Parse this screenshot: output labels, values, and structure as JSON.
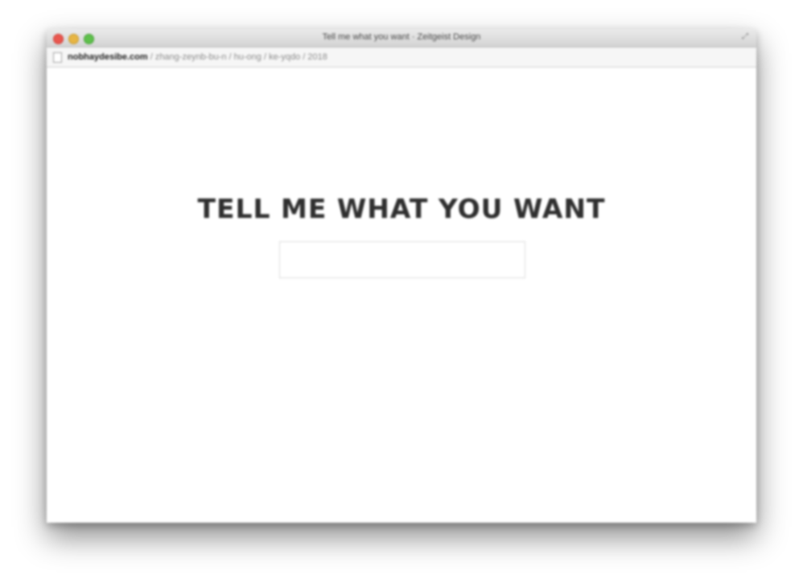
{
  "window": {
    "title": "Tell me what you want · Zeitgeist Design",
    "url_domain": "nobhaydesibe.com",
    "url_path": "/ zhang-zeynb-bu-n / hu-ong / ke-yqdo / 2018"
  },
  "page": {
    "headline": "TELL ME WHAT YOU WANT",
    "input_value": "",
    "input_placeholder": ""
  },
  "icons": {
    "close": "close-icon",
    "minimize": "minimize-icon",
    "maximize": "maximize-icon",
    "fullscreen": "fullscreen-icon",
    "page": "page-icon"
  },
  "colors": {
    "close": "#e9574f",
    "minimize": "#e7b543",
    "maximize": "#5fc04c",
    "headline": "#2f2f2f"
  }
}
